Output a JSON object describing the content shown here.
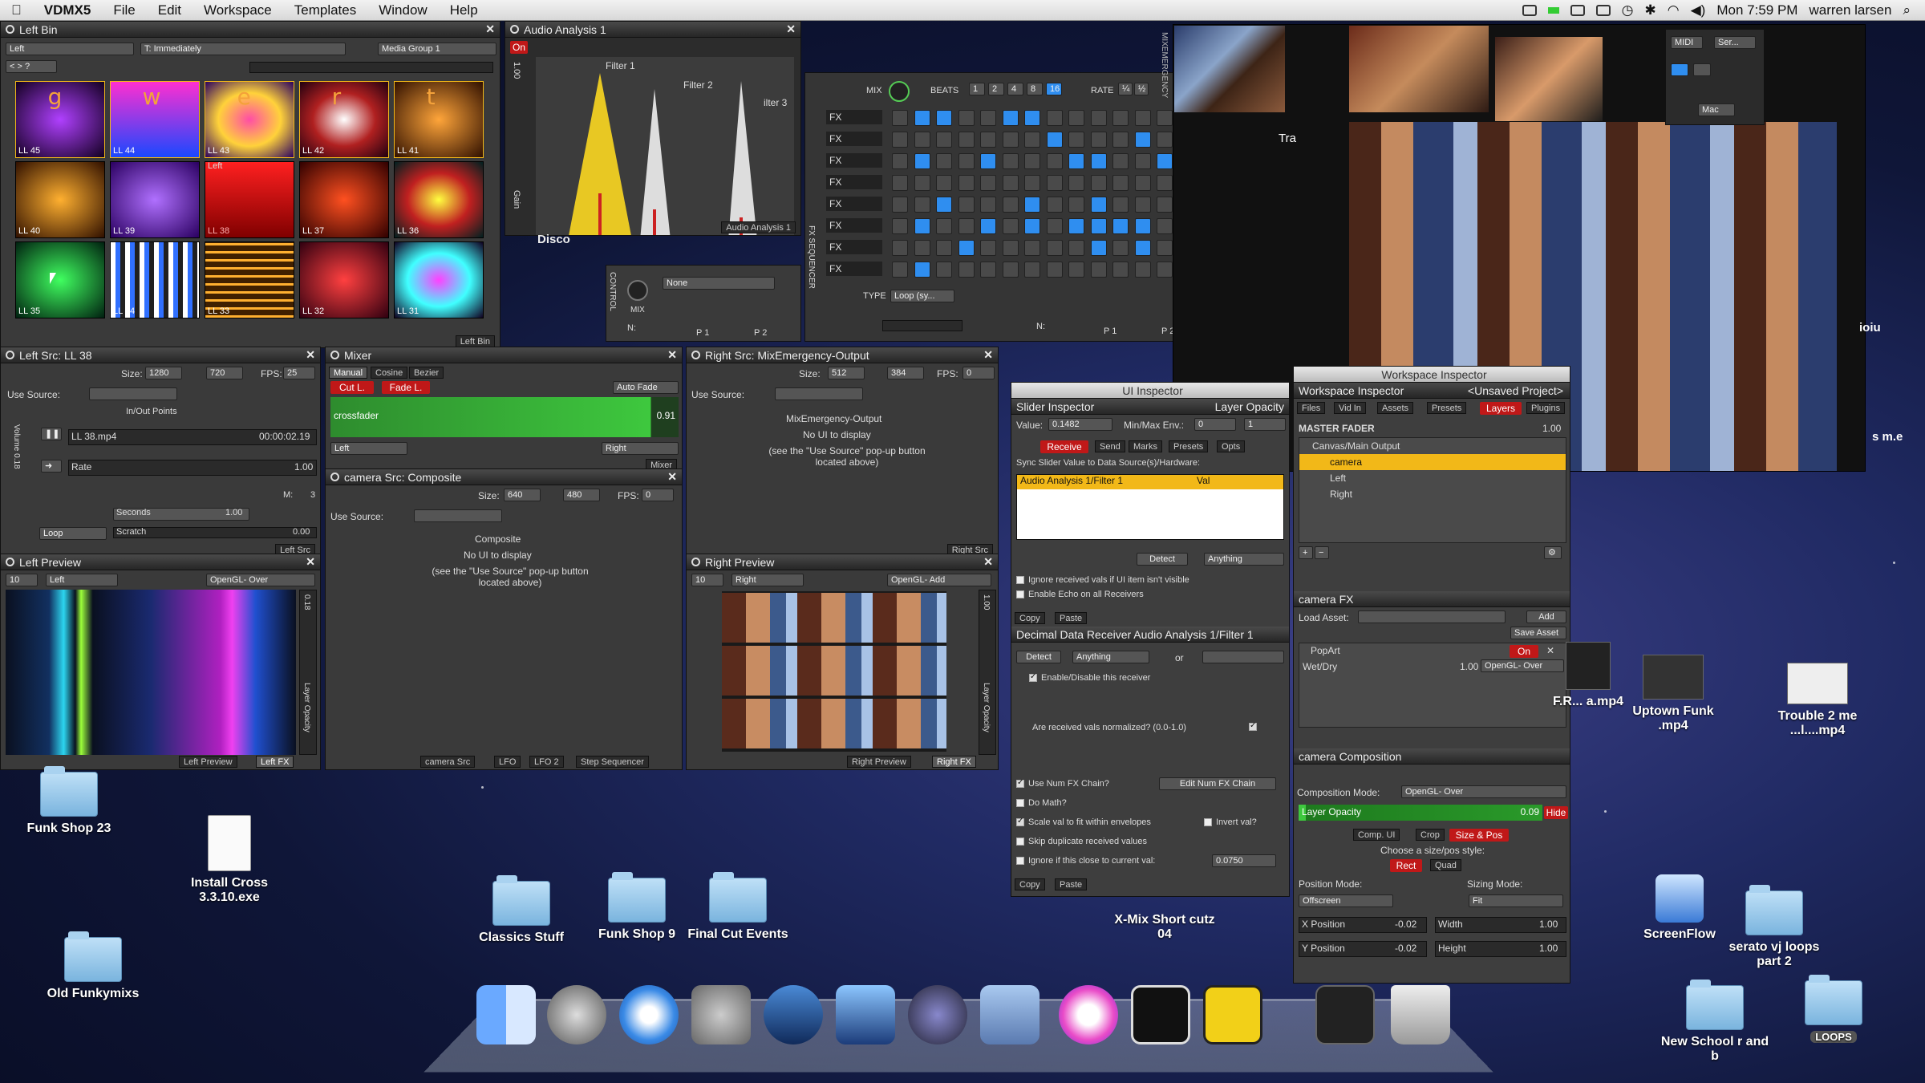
{
  "menubar": {
    "app": "VDMX5",
    "items": [
      "File",
      "Edit",
      "Workspace",
      "Templates",
      "Window",
      "Help"
    ],
    "clock": "Mon 7:59 PM",
    "user": "warren larsen"
  },
  "left_bin": {
    "title": "Left Bin",
    "mode": "Left",
    "trigger": "T: Immediately",
    "group": "Media Group 1",
    "footer": "Left Bin",
    "clips": [
      {
        "label": "LL 45",
        "letter": "g"
      },
      {
        "label": "LL 44",
        "letter": "w"
      },
      {
        "label": "LL 43",
        "letter": "e"
      },
      {
        "label": "LL 42",
        "letter": "r"
      },
      {
        "label": "LL 41",
        "letter": "t"
      },
      {
        "label": "LL 40",
        "letter": ""
      },
      {
        "label": "LL 39",
        "letter": ""
      },
      {
        "label": "LL 38",
        "letter": ""
      },
      {
        "label": "LL 37",
        "letter": ""
      },
      {
        "label": "LL 36",
        "letter": ""
      },
      {
        "label": "LL 35",
        "letter": ""
      },
      {
        "label": "LL 34",
        "letter": ""
      },
      {
        "label": "LL 33",
        "letter": ""
      },
      {
        "label": "LL 32",
        "letter": ""
      },
      {
        "label": "LL 31",
        "letter": ""
      }
    ],
    "selected_caption": "Left"
  },
  "audio_analysis": {
    "title": "Audio Analysis 1",
    "on": "On",
    "filters": [
      "Filter 1",
      "Filter 2",
      "ilter 3"
    ],
    "footer": "Audio Analysis 1",
    "side_a": "1.00",
    "side_b": "Gain"
  },
  "disco": "Disco",
  "control": {
    "label": "CONTROL",
    "mix": "MIX",
    "select": "None",
    "p1": "P 1",
    "p2": "P 2",
    "n": "N:"
  },
  "sequencer": {
    "label": "FX SEQUENCER",
    "mix": "MIX",
    "beats_label": "BEATS",
    "beats": [
      "1",
      "2",
      "4",
      "8",
      "16"
    ],
    "rate_label": "RATE",
    "rate": [
      "¼",
      "½"
    ],
    "type_label": "TYPE",
    "type": "Loop (sy...",
    "row_label": "FX",
    "p1": "P 1",
    "p2": "P 2",
    "n": "N:",
    "rows": [
      [
        0,
        1,
        1,
        0,
        0,
        1,
        1,
        0,
        0,
        0,
        0,
        0,
        0,
        0,
        0,
        0,
        0,
        0
      ],
      [
        0,
        0,
        0,
        0,
        0,
        0,
        0,
        1,
        0,
        0,
        0,
        1,
        0,
        1,
        0,
        0,
        0,
        0
      ],
      [
        0,
        1,
        0,
        0,
        1,
        0,
        0,
        0,
        1,
        1,
        0,
        0,
        1,
        0,
        0,
        1,
        0,
        1
      ],
      [
        0,
        0,
        0,
        0,
        0,
        0,
        0,
        0,
        0,
        0,
        0,
        0,
        0,
        0,
        0,
        0,
        0,
        0
      ],
      [
        0,
        0,
        1,
        0,
        0,
        0,
        1,
        0,
        0,
        1,
        0,
        0,
        0,
        0,
        1,
        0,
        0,
        0
      ],
      [
        0,
        1,
        0,
        0,
        1,
        0,
        1,
        0,
        1,
        1,
        1,
        1,
        0,
        0,
        0,
        1,
        0,
        1
      ],
      [
        0,
        0,
        0,
        1,
        0,
        0,
        0,
        0,
        0,
        1,
        0,
        1,
        0,
        1,
        0,
        0,
        1,
        1
      ],
      [
        0,
        1,
        0,
        0,
        0,
        0,
        0,
        0,
        0,
        0,
        0,
        0,
        0,
        0,
        0,
        0,
        0,
        0
      ]
    ]
  },
  "left_src": {
    "title": "Left Src: LL 38",
    "size_label": "Size:",
    "w": "1280",
    "h": "720",
    "fps_label": "FPS:",
    "fps": "25",
    "use_source": "Use Source:",
    "inout": "In/Out Points",
    "file": "LL 38.mp4",
    "time": "00:00:02.19",
    "rate_label": "Rate",
    "rate": "1.00",
    "seconds": "Seconds",
    "seconds_val": "1.00",
    "m": "M:",
    "m_val": "3",
    "loop": "Loop",
    "scratch": "Scratch",
    "scratch_val": "0.00",
    "footer": "Left Src",
    "vol": "Volume 0.18"
  },
  "mixer": {
    "title": "Mixer",
    "tabs": [
      "Manual",
      "Cosine",
      "Bezier"
    ],
    "cut": "Cut L.",
    "fade": "Fade L.",
    "auto": "Auto Fade",
    "cross": "crossfader",
    "val": "0.91",
    "left": "Left",
    "right": "Right",
    "footer": "Mixer"
  },
  "camera_src": {
    "title": "camera Src: Composite",
    "use_source": "Use Source:",
    "size_label": "Size:",
    "w": "640",
    "h": "480",
    "fps_label": "FPS:",
    "fps": "0",
    "name": "Composite",
    "noui": "No UI to display",
    "hint": "(see the \"Use Source\" pop-up button located above)",
    "tabs": [
      "camera Src",
      "LFO",
      "LFO 2",
      "Step Sequencer"
    ]
  },
  "right_src": {
    "title": "Right Src: MixEmergency-Output",
    "size_label": "Size:",
    "w": "512",
    "h": "384",
    "fps_label": "FPS:",
    "fps": "0",
    "use_source": "Use Source:",
    "name": "MixEmergency-Output",
    "noui": "No UI to display",
    "hint": "(see the \"Use Source\" pop-up button located above)",
    "footer": "Right Src"
  },
  "left_preview": {
    "title": "Left Preview",
    "zoom": "10",
    "src": "Left",
    "mode": "OpenGL- Over",
    "opacity": "0.18",
    "op_label": "Layer Opacity",
    "tabs": [
      "Left Preview",
      "Left FX"
    ]
  },
  "right_preview": {
    "title": "Right Preview",
    "zoom": "10",
    "src": "Right",
    "mode": "OpenGL- Add",
    "opacity": "1.00",
    "op_label": "Layer Opacity",
    "tabs": [
      "Right Preview",
      "Right FX"
    ]
  },
  "ui_inspector": {
    "title": "UI Inspector",
    "sub": "Slider Inspector",
    "target": "Layer Opacity",
    "value_label": "Value:",
    "value": "0.1482",
    "minmax": "Min/Max Env.:",
    "min": "0",
    "max": "1",
    "tabs": [
      "Receive",
      "Send",
      "Marks",
      "Presets",
      "Opts"
    ],
    "sync": "Sync Slider Value to Data Source(s)/Hardware:",
    "source": "Audio Analysis 1/Filter 1",
    "val": "Val",
    "detect": "Detect",
    "anything": "Anything",
    "ignore": "Ignore received vals if UI item isn't visible",
    "echo": "Enable Echo on all Receivers",
    "copy": "Copy",
    "paste": "Paste",
    "decimal": "Decimal Data Receiver Audio Analysis 1/Filter 1",
    "or": "or",
    "enable": "Enable/Disable this receiver",
    "normalized": "Are received vals normalized? (0.0-1.0)",
    "numfx": "Use Num FX Chain?",
    "editfx": "Edit Num FX Chain",
    "math": "Do Math?",
    "scale": "Scale val to fit within envelopes",
    "invert": "Invert val?",
    "skip": "Skip duplicate received values",
    "ignoreclose": "Ignore if this close to current val:",
    "close_val": "0.0750"
  },
  "workspace": {
    "title": "Workspace Inspector",
    "sub": "Workspace Inspector",
    "project": "<Unsaved Project>",
    "tabs": [
      "Files",
      "Vid In",
      "Assets",
      "Presets",
      "Layers",
      "Plugins"
    ],
    "master": "MASTER FADER",
    "master_val": "1.00",
    "tree": [
      "Canvas/Main Output",
      "camera",
      "Left",
      "Right"
    ]
  },
  "camera_fx": {
    "title": "camera FX",
    "load": "Load Asset:",
    "add": "Add",
    "save": "Save Asset",
    "fx": "PopArt",
    "on": "On",
    "wet": "Wet/Dry",
    "wet_val": "1.00",
    "mode": "OpenGL- Over"
  },
  "camera_comp": {
    "title": "camera Composition",
    "mode_label": "Composition Mode:",
    "mode": "OpenGL- Over",
    "opacity": "Layer Opacity",
    "op_val": "0.09",
    "hide": "Hide",
    "tabs": [
      "Comp. UI",
      "Crop",
      "Size & Pos"
    ],
    "style": "Choose a size/pos style:",
    "rect": "Rect",
    "quad": "Quad",
    "pos_mode": "Position Mode:",
    "size_mode": "Sizing Mode:",
    "pos_sel": "Offscreen",
    "size_sel": "Fit",
    "xpos": "X Position",
    "xval": "-0.02",
    "ypos": "Y Position",
    "yval": "-0.02",
    "width": "Width",
    "wval": "1.00",
    "height": "Height",
    "hval": "1.00"
  },
  "small_ctl": {
    "midi": "MIDI",
    "ser": "Ser...",
    "mac": "Mac"
  },
  "side_text": {
    "mix": "MIXEMERGENCY",
    "trans": "Tra",
    "ioiu": "ioiu",
    "sme": "s m.e"
  },
  "desktop": [
    {
      "name": "Funk Shop 23",
      "kind": "folder"
    },
    {
      "name": "Install Cross 3.3.10.exe",
      "kind": "file"
    },
    {
      "name": "Old Funkymixs",
      "kind": "folder"
    },
    {
      "name": "Classics Stuff",
      "kind": "folder"
    },
    {
      "name": "Funk Shop 9",
      "kind": "folder"
    },
    {
      "name": "Final Cut Events",
      "kind": "folder"
    },
    {
      "name": "X-Mix Short cutz 04",
      "kind": "text"
    },
    {
      "name": "F.R... a.mp4",
      "kind": "video"
    },
    {
      "name": "Uptown Funk .mp4",
      "kind": "video"
    },
    {
      "name": "Trouble 2 me ...l....mp4",
      "kind": "video"
    },
    {
      "name": "ScreenFlow",
      "kind": "app"
    },
    {
      "name": "serato vj loops part 2",
      "kind": "folder"
    },
    {
      "name": "New School r and b",
      "kind": "folder"
    },
    {
      "name": "LOOPS",
      "kind": "folder"
    }
  ]
}
